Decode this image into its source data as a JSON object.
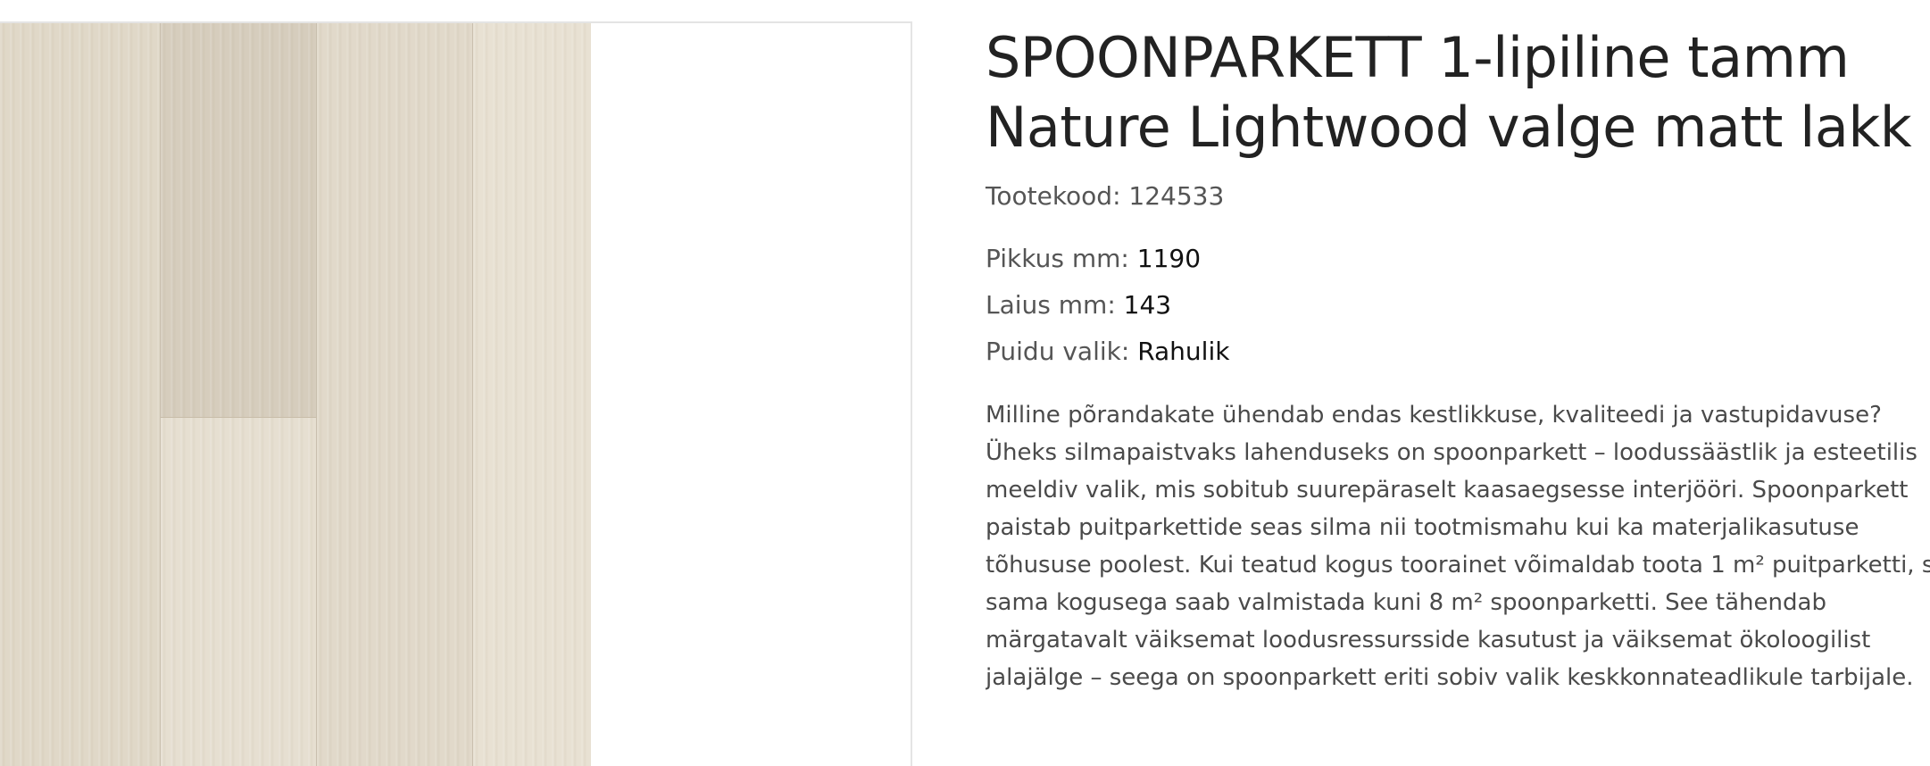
{
  "product": {
    "title_line1": "SPOONPARKETT 1-lipiline tamm",
    "title_line2": "Nature Lightwood valge matt lakk",
    "code_label": "Tootekood:",
    "code_value": "124533"
  },
  "specs": [
    {
      "label": "Pikkus mm:",
      "value": "1190"
    },
    {
      "label": "Laius mm:",
      "value": "143"
    },
    {
      "label": "Puidu valik:",
      "value": "Rahulik"
    }
  ],
  "description_lines": [
    "Milline põrandakate ühendab endas kestlikkuse, kvaliteedi ja vastupidavuse?",
    "Üheks silmapaistvaks lahenduseks on spoonparkett – loodussäästlik ja esteetilis",
    "meeldiv valik, mis sobitub suurepäraselt kaasaegsesse interjööri. Spoonparkett",
    "paistab puitparkettide seas silma nii tootmismahu kui ka materjalikasutuse",
    "tõhususe poolest. Kui teatud kogus toorainet võimaldab toota 1 m² puitparketti, s",
    "sama kogusega saab valmistada kuni 8 m² spoonparketti. See tähendab",
    "märgatavalt väiksemat loodusressursside kasutust ja väiksemat ökoloogilist",
    "jalajälge – seega on spoonparkett eriti sobiv valik keskkonnateadlikule tarbijale."
  ]
}
